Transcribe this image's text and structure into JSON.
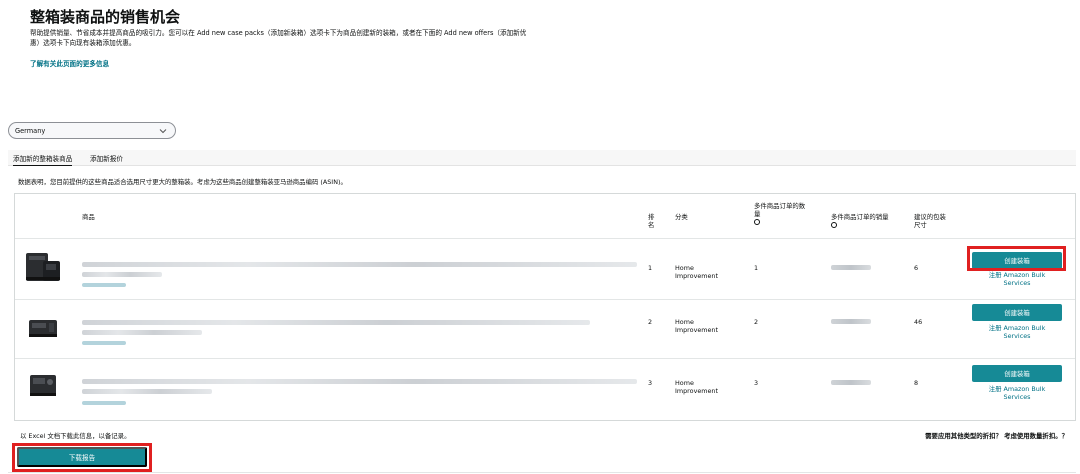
{
  "header": {
    "title": "整箱装商品的销售机会",
    "description": "帮助提供销量、节省成本并提高商品的吸引力。您可以在 Add new case packs（添加新装箱）选项卡下为商品创建新的装箱，或者在下面的 Add new offers（添加新优惠）选项卡下向现有装箱添加优惠。",
    "learn_more": "了解有关此页面的更多信息"
  },
  "marketplace": {
    "selected": "Germany"
  },
  "tabs": [
    {
      "label": "添加新的整箱装商品",
      "active": true
    },
    {
      "label": "添加新报价",
      "active": false
    }
  ],
  "data_note": "数据表明，您目前提供的这些商品适合选用尺寸更大的整箱装。考虑为这些商品创建整箱装亚马逊商品编码 (ASIN)。",
  "table": {
    "columns": {
      "product": "商品",
      "rank_1": "排",
      "rank_2": "名",
      "category": "分类",
      "multi_orders_1": "多件商品订单的数",
      "multi_orders_2": "量",
      "multi_sales": "多件商品订单的销量",
      "pack_size_1": "建议的包装",
      "pack_size_2": "尺寸"
    },
    "rows": [
      {
        "rank": "1",
        "category_1": "Home",
        "category_2": "Improvement",
        "multi_orders": "1",
        "pack_size": "6",
        "create_label": "创建装箱",
        "bulk_1": "注册 Amazon Bulk",
        "bulk_2": "Services"
      },
      {
        "rank": "2",
        "category_1": "Home",
        "category_2": "Improvement",
        "multi_orders": "2",
        "pack_size": "46",
        "create_label": "创建装箱",
        "bulk_1": "注册 Amazon Bulk",
        "bulk_2": "Services"
      },
      {
        "rank": "3",
        "category_1": "Home",
        "category_2": "Improvement",
        "multi_orders": "3",
        "pack_size": "8",
        "create_label": "创建装箱",
        "bulk_1": "注册 Amazon Bulk",
        "bulk_2": "Services"
      }
    ]
  },
  "footer": {
    "excel_note": "以 Excel 文档下载此信息，以备记录。",
    "discount_text": "需要应用其他类型的折扣？ 考虑使用数量折扣。？",
    "download_label": "下载报告"
  },
  "colors": {
    "primary_button": "#168a96",
    "link": "#007185",
    "highlight": "#e02020"
  }
}
